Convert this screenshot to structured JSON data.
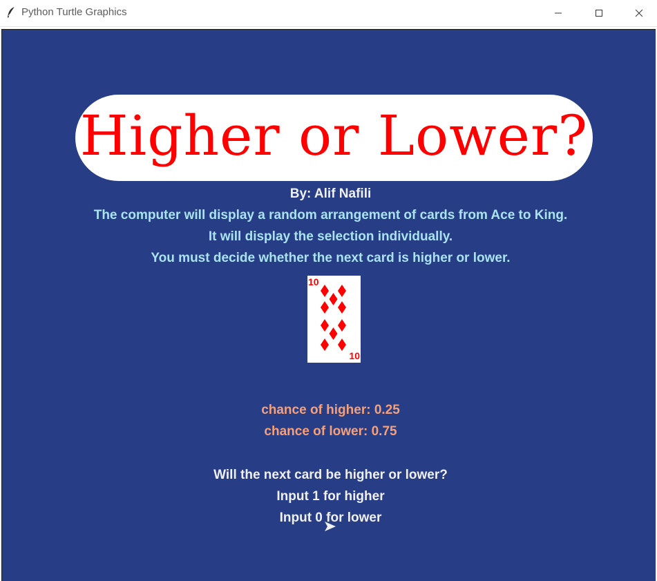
{
  "window": {
    "title": "Python Turtle Graphics",
    "controls": {
      "minimize_icon": "minimize-icon",
      "maximize_icon": "maximize-icon",
      "close_icon": "close-icon"
    },
    "app_icon": "feather-icon"
  },
  "canvas": {
    "background": "#273e87",
    "banner": {
      "title": "Higher or Lower?",
      "text_color": "#ff0000",
      "background": "#ffffff"
    },
    "author": "By: Alif Nafili",
    "intro": [
      "The computer will display a random arrangement of cards from Ace to King.",
      "It will display the selection individually.",
      "You must decide whether the next card is higher or lower."
    ],
    "card": {
      "rank": "10",
      "suit": "diamonds",
      "color": "#ff0000"
    },
    "odds": {
      "higher": "chance of higher: 0.25",
      "lower": "chance of lower: 0.75",
      "color": "#f5a07a"
    },
    "prompt": [
      "Will the next card be higher or lower?",
      "Input 1 for higher",
      "Input 0 for lower"
    ],
    "cursor_icon": "turtle-arrow-icon"
  }
}
